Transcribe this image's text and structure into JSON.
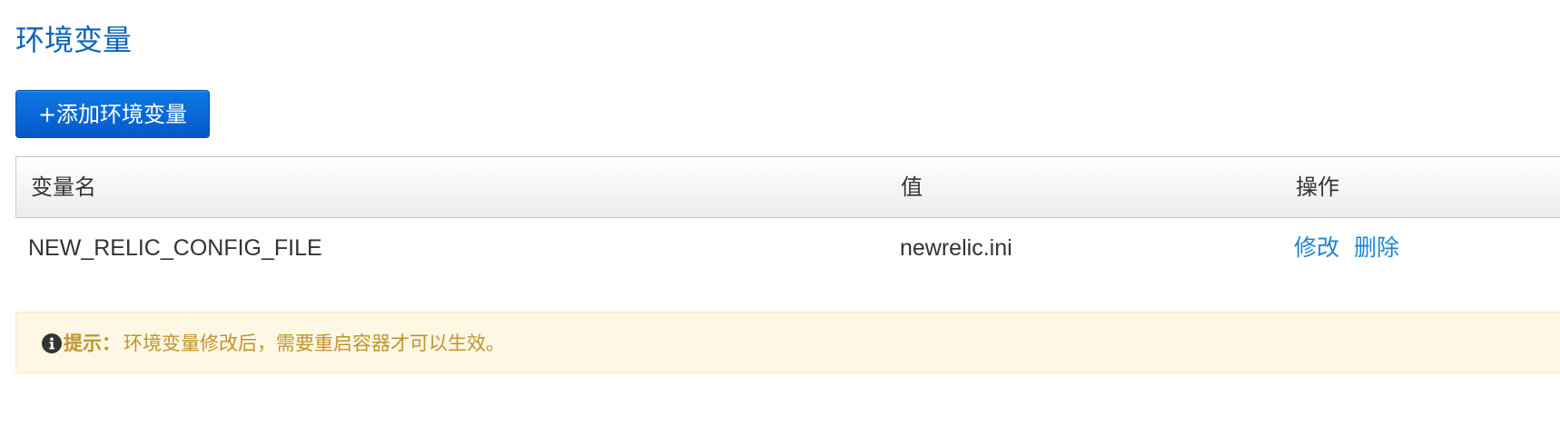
{
  "page": {
    "title": "环境变量"
  },
  "toolbar": {
    "add_label": "+添加环境变量"
  },
  "table": {
    "headers": {
      "name": "变量名",
      "value": "值",
      "actions": "操作"
    },
    "rows": [
      {
        "name": "NEW_RELIC_CONFIG_FILE",
        "value": "newrelic.ini",
        "edit_label": "修改",
        "delete_label": "删除"
      }
    ]
  },
  "notice": {
    "icon": "info-icon",
    "label": "提示：",
    "text": "环境变量修改后，需要重启容器才可以生效。"
  },
  "colors": {
    "title": "#0a63b8",
    "primary_button": "#0659c8",
    "link": "#1b86d6",
    "notice_background": "#fdf7e4",
    "notice_text": "#c0952e"
  }
}
